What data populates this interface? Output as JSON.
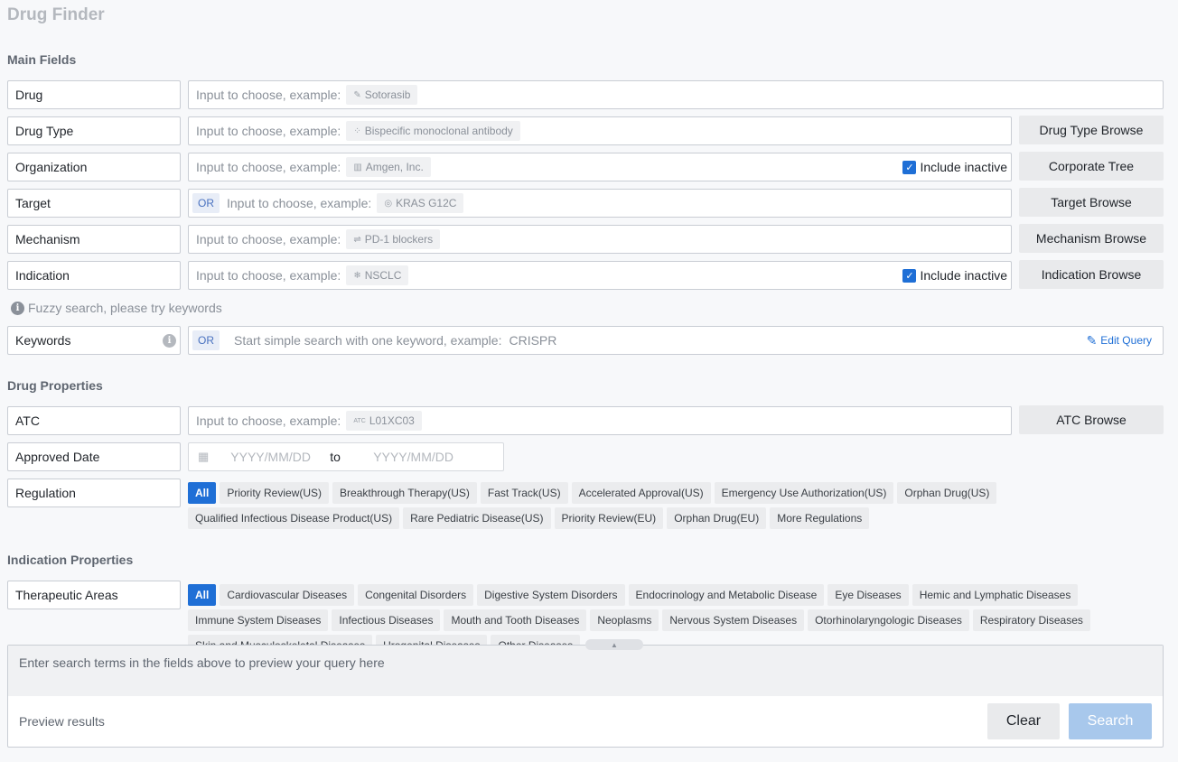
{
  "title": "Drug Finder",
  "sections": {
    "main": "Main Fields",
    "drug_props": "Drug Properties",
    "indication_props": "Indication Properties"
  },
  "placeholder_prefix": "Input to choose, example:",
  "fields": {
    "drug": {
      "label": "Drug",
      "example": "Sotorasib",
      "icon": "pill-icon"
    },
    "drug_type": {
      "label": "Drug Type",
      "example": "Bispecific monoclonal antibody",
      "icon": "molecule-icon",
      "browse": "Drug Type Browse"
    },
    "organization": {
      "label": "Organization",
      "example": "Amgen, Inc.",
      "icon": "building-icon",
      "browse": "Corporate Tree",
      "include_inactive": "Include inactive"
    },
    "target": {
      "label": "Target",
      "example": "KRAS G12C",
      "icon": "target-icon",
      "browse": "Target Browse",
      "or": "OR"
    },
    "mechanism": {
      "label": "Mechanism",
      "example": "PD-1 blockers",
      "icon": "arrows-icon",
      "browse": "Mechanism Browse"
    },
    "indication": {
      "label": "Indication",
      "example": "NSCLC",
      "icon": "virus-icon",
      "browse": "Indication Browse",
      "include_inactive": "Include inactive"
    },
    "keywords": {
      "label": "Keywords",
      "or": "OR",
      "placeholder": "Start simple search with one keyword, example:",
      "example": "CRISPR",
      "edit_query": "Edit Query"
    },
    "atc": {
      "label": "ATC",
      "example": "L01XC03",
      "icon_text": "ATC",
      "browse": "ATC Browse"
    },
    "approved_date": {
      "label": "Approved Date",
      "from": "YYYY/MM/DD",
      "to_label": "to",
      "to": "YYYY/MM/DD"
    },
    "regulation": {
      "label": "Regulation"
    },
    "therapeutic_areas": {
      "label": "Therapeutic Areas"
    }
  },
  "fuzzy_hint": "Fuzzy search, please try keywords",
  "regulation_tags_row1": [
    "All",
    "Priority Review(US)",
    "Breakthrough Therapy(US)",
    "Fast Track(US)",
    "Accelerated Approval(US)",
    "Emergency Use Authorization(US)",
    "Orphan Drug(US)"
  ],
  "regulation_tags_row2": [
    "Qualified Infectious Disease Product(US)",
    "Rare Pediatric Disease(US)",
    "Priority Review(EU)",
    "Orphan Drug(EU)",
    "More Regulations"
  ],
  "ta_tags_row1": [
    "All",
    "Cardiovascular Diseases",
    "Congenital Disorders",
    "Digestive System Disorders",
    "Endocrinology and Metabolic Disease",
    "Eye Diseases",
    "Hemic and Lymphatic Diseases"
  ],
  "ta_tags_row2": [
    "Immune System Diseases",
    "Infectious Diseases",
    "Mouth and Tooth Diseases",
    "Neoplasms",
    "Nervous System Diseases",
    "Otorhinolaryngologic Diseases",
    "Respiratory Diseases"
  ],
  "ta_tags_row3": [
    "Skin and Musculoskeletal Diseases",
    "Urogenital Diseases",
    "Other Diseases"
  ],
  "preview": {
    "placeholder": "Enter search terms in the fields above to preview your query here",
    "results_label": "Preview results",
    "clear": "Clear",
    "search": "Search"
  },
  "colors": {
    "accent": "#1f6fd6",
    "search_disabled": "#a8c8ec"
  }
}
